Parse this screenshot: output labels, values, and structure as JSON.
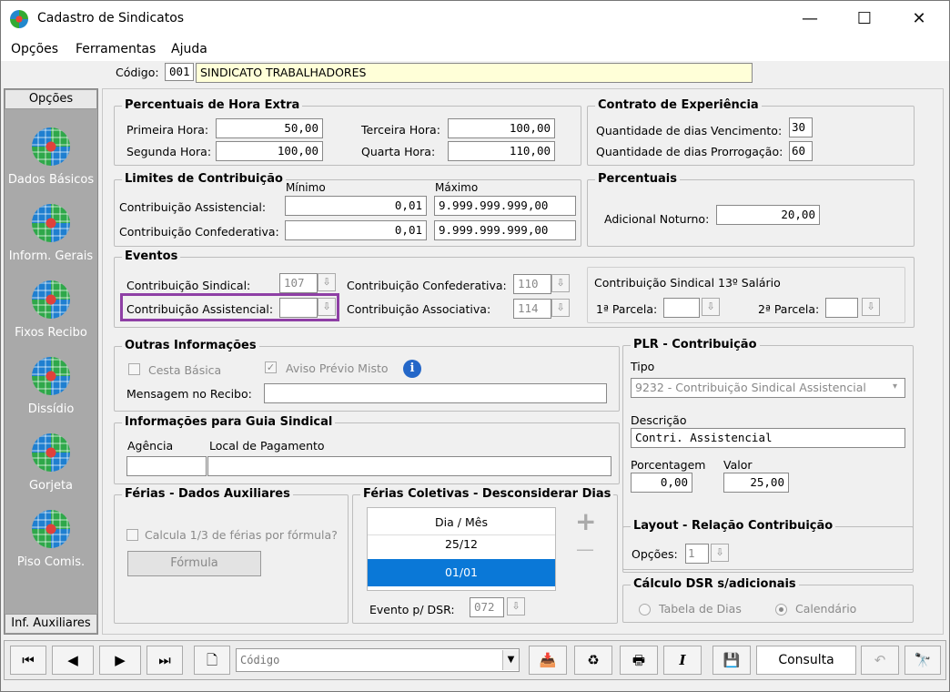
{
  "window": {
    "title": "Cadastro de Sindicatos",
    "minimize": "—",
    "maximize": "☐",
    "close": "✕"
  },
  "menu": {
    "opcoes": "Opções",
    "ferramentas": "Ferramentas",
    "ajuda": "Ajuda"
  },
  "codigo": {
    "label": "Código:",
    "num": "001",
    "name": "SINDICATO TRABALHADORES"
  },
  "sidebar": {
    "header": "Opções",
    "footer": "Inf. Auxiliares",
    "items": [
      {
        "label": "Dados Básicos"
      },
      {
        "label": "Inform. Gerais"
      },
      {
        "label": "Fixos Recibo"
      },
      {
        "label": "Dissídio"
      },
      {
        "label": "Gorjeta"
      },
      {
        "label": "Piso Comis."
      }
    ]
  },
  "hora_extra": {
    "title": "Percentuais de Hora Extra",
    "primeira_label": "Primeira Hora:",
    "primeira": "50,00",
    "segunda_label": "Segunda Hora:",
    "segunda": "100,00",
    "terceira_label": "Terceira Hora:",
    "terceira": "100,00",
    "quarta_label": "Quarta Hora:",
    "quarta": "110,00"
  },
  "contrato": {
    "title": "Contrato de Experiência",
    "venc_label": "Quantidade de dias Vencimento:",
    "venc": "30",
    "prorr_label": "Quantidade de dias Prorrogação:",
    "prorr": "60"
  },
  "limites": {
    "title": "Limites de Contribuição",
    "minimo": "Mínimo",
    "maximo": "Máximo",
    "assist_label": "Contribuição Assistencial:",
    "assist_min": "0,01",
    "assist_max": "9.999.999.999,00",
    "confed_label": "Contribuição Confederativa:",
    "confed_min": "0,01",
    "confed_max": "9.999.999.999,00"
  },
  "percentuais": {
    "title": "Percentuais",
    "noturno_label": "Adicional Noturno:",
    "noturno": "20,00"
  },
  "eventos": {
    "title": "Eventos",
    "sindical_label": "Contribuição Sindical:",
    "sindical": "107",
    "assist_label": "Contribuição Assistencial:",
    "assist": "",
    "confed_label": "Contribuição Confederativa:",
    "confed": "110",
    "assoc_label": "Contribuição Associativa:",
    "assoc": "114",
    "sal13_title": "Contribuição Sindical 13º Salário",
    "parcela1_label": "1ª Parcela:",
    "parcela1": "",
    "parcela2_label": "2ª Parcela:",
    "parcela2": ""
  },
  "outras": {
    "title": "Outras Informações",
    "cesta_label": "Cesta Básica",
    "aviso_label": "Aviso Prévio Misto",
    "mensagem_label": "Mensagem no Recibo:",
    "mensagem": ""
  },
  "plr": {
    "title": "PLR - Contribuição",
    "tipo_label": "Tipo",
    "tipo": "9232 - Contribuição Sindical Assistencial",
    "descricao_label": "Descrição",
    "descricao": "Contri. Assistencial",
    "porcentagem_label": "Porcentagem",
    "porcentagem": "0,00",
    "valor_label": "Valor",
    "valor": "25,00"
  },
  "guia": {
    "title": "Informações para Guia Sindical",
    "agencia_label": "Agência",
    "agencia": "",
    "local_label": "Local de Pagamento",
    "local": ""
  },
  "ferias": {
    "title": "Férias - Dados Auxiliares",
    "calcula_label": "Calcula 1/3 de férias por fórmula?",
    "formula_btn": "Fórmula"
  },
  "coletivas": {
    "title": "Férias Coletivas - Desconsiderar Dias",
    "col_header": "Dia / Mês",
    "rows": [
      "25/12",
      "01/01"
    ],
    "evento_label": "Evento p/ DSR:",
    "evento": "072",
    "add": "+",
    "remove": "—"
  },
  "layout": {
    "title": "Layout - Relação Contribuição",
    "opcoes_label": "Opções:",
    "opcoes": "1"
  },
  "dsr": {
    "title": "Cálculo DSR s/adicionais",
    "tabela_label": "Tabela de Dias",
    "calendario_label": "Calendário"
  },
  "toolbar": {
    "first": "⏮",
    "prev": "◀",
    "next": "▶",
    "last": "⏭",
    "search_placeholder": "Código",
    "mode": "Consulta"
  }
}
